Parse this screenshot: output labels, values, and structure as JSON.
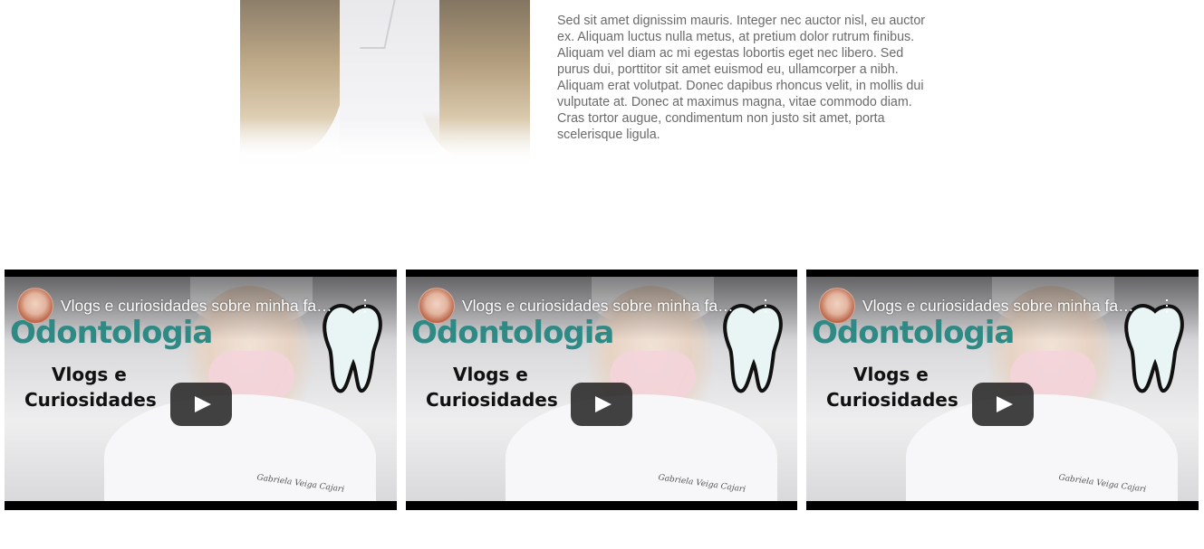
{
  "about": {
    "paragraph": "Sed sit amet dignissim mauris. Integer nec auctor nisl, eu auctor ex. Aliquam luctus nulla metus, at pretium dolor rutrum finibus. Aliquam vel diam ac mi egestas lobortis eget nec libero. Sed purus dui, porttitor sit amet euismod eu, ullamcorper a nibh. Aliquam erat volutpat. Donec dapibus rhoncus velit, in mollis dui vulputate at. Donec at maximus magna, vitae commodo diam. Cras tortor augue, condimentum non justo sit amet, porta scelerisque ligula."
  },
  "videos": [
    {
      "title": "Vlogs e curiosidades sobre minha faculdade de odontologia",
      "thumbnail": {
        "line1": "Odontologia",
        "line2": "Vlogs e",
        "line3": "Curiosidades",
        "signature": "Gabriela Veiga Cajari"
      },
      "icons": {
        "avatar": "channel-avatar",
        "menu": "more-vertical-icon",
        "play": "play-icon"
      }
    },
    {
      "title": "Vlogs e curiosidades sobre minha faculdade de odontologia",
      "thumbnail": {
        "line1": "Odontologia",
        "line2": "Vlogs e",
        "line3": "Curiosidades",
        "signature": "Gabriela Veiga Cajari"
      },
      "icons": {
        "avatar": "channel-avatar",
        "menu": "more-vertical-icon",
        "play": "play-icon"
      }
    },
    {
      "title": "Vlogs e curiosidades sobre minha faculdade de odontologia",
      "thumbnail": {
        "line1": "Odontologia",
        "line2": "Vlogs e",
        "line3": "Curiosidades",
        "signature": "Gabriela Veiga Cajari"
      },
      "icons": {
        "avatar": "channel-avatar",
        "menu": "more-vertical-icon",
        "play": "play-icon"
      }
    }
  ],
  "colors": {
    "body_text": "#6a6a6a",
    "brand_teal": "#2f8a85",
    "play_button": "#212121"
  }
}
